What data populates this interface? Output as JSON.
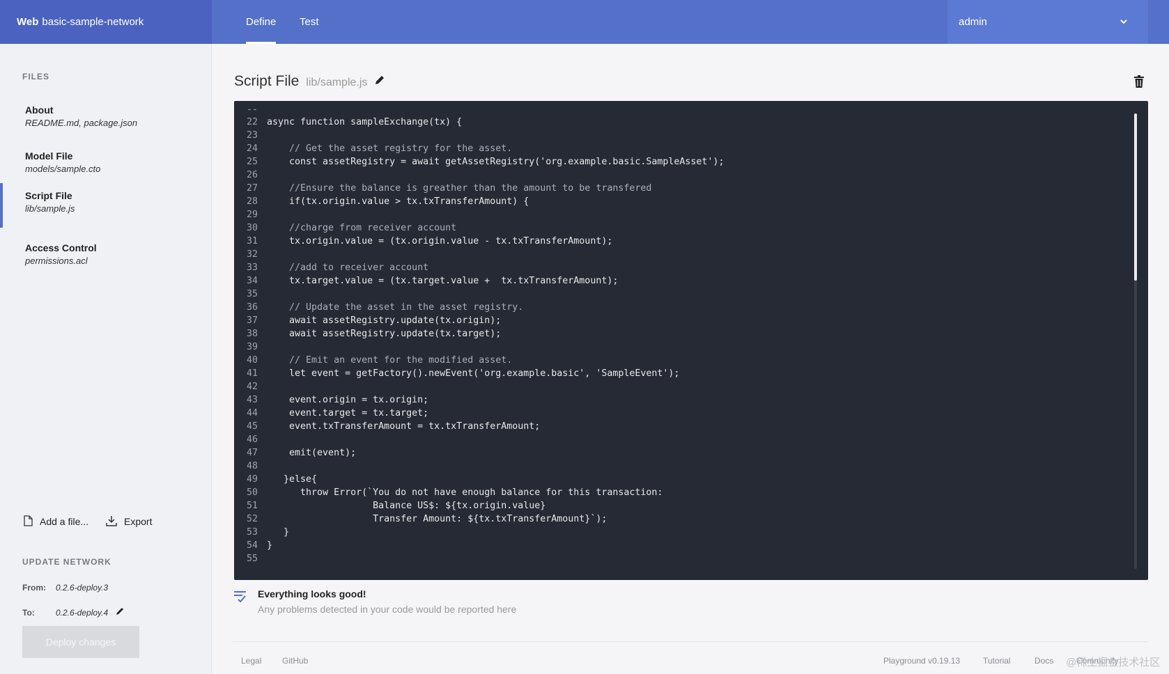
{
  "app": {
    "brand_bold": "Web",
    "brand_name": "basic-sample-network"
  },
  "nav": {
    "tabs": [
      "Define",
      "Test"
    ],
    "active": "Define"
  },
  "user": {
    "name": "admin"
  },
  "sidebar": {
    "files_title": "FILES",
    "files": [
      {
        "name": "About",
        "path": "README.md, package.json"
      },
      {
        "name": "Model File",
        "path": "models/sample.cto"
      },
      {
        "name": "Script File",
        "path": "lib/sample.js"
      },
      {
        "name": "Access Control",
        "path": "permissions.acl"
      }
    ],
    "active_file": "Script File",
    "add_file_label": "Add a file...",
    "export_label": "Export",
    "update_title": "UPDATE NETWORK",
    "from_label": "From:",
    "from_value": "0.2.6-deploy.3",
    "to_label": "To:",
    "to_value": "0.2.6-deploy.4",
    "deploy_label": "Deploy changes"
  },
  "main": {
    "title": "Script File",
    "path": "lib/sample.js"
  },
  "code": [
    {
      "n": "22",
      "t": "async function sampleExchange(tx) {"
    },
    {
      "n": "23",
      "t": ""
    },
    {
      "n": "24",
      "t": "    // Get the asset registry for the asset."
    },
    {
      "n": "25",
      "t": "    const assetRegistry = await getAssetRegistry('org.example.basic.SampleAsset');"
    },
    {
      "n": "26",
      "t": ""
    },
    {
      "n": "27",
      "t": "    //Ensure the balance is greather than the amount to be transfered"
    },
    {
      "n": "28",
      "t": "    if(tx.origin.value > tx.txTransferAmount) {"
    },
    {
      "n": "29",
      "t": ""
    },
    {
      "n": "30",
      "t": "    //charge from receiver account"
    },
    {
      "n": "31",
      "t": "    tx.origin.value = (tx.origin.value - tx.txTransferAmount);"
    },
    {
      "n": "32",
      "t": ""
    },
    {
      "n": "33",
      "t": "    //add to receiver account"
    },
    {
      "n": "34",
      "t": "    tx.target.value = (tx.target.value +  tx.txTransferAmount);"
    },
    {
      "n": "35",
      "t": ""
    },
    {
      "n": "36",
      "t": "    // Update the asset in the asset registry."
    },
    {
      "n": "37",
      "t": "    await assetRegistry.update(tx.origin);"
    },
    {
      "n": "38",
      "t": "    await assetRegistry.update(tx.target);"
    },
    {
      "n": "39",
      "t": ""
    },
    {
      "n": "40",
      "t": "    // Emit an event for the modified asset."
    },
    {
      "n": "41",
      "t": "    let event = getFactory().newEvent('org.example.basic', 'SampleEvent');"
    },
    {
      "n": "42",
      "t": ""
    },
    {
      "n": "43",
      "t": "    event.origin = tx.origin;"
    },
    {
      "n": "44",
      "t": "    event.target = tx.target;"
    },
    {
      "n": "45",
      "t": "    event.txTransferAmount = tx.txTransferAmount;"
    },
    {
      "n": "46",
      "t": ""
    },
    {
      "n": "47",
      "t": "    emit(event);"
    },
    {
      "n": "48",
      "t": ""
    },
    {
      "n": "49",
      "t": "   }else{"
    },
    {
      "n": "50",
      "t": "      throw Error(`You do not have enough balance for this transaction:"
    },
    {
      "n": "51",
      "t": "                   Balance US$: ${tx.origin.value}"
    },
    {
      "n": "52",
      "t": "                   Transfer Amount: ${tx.txTransferAmount}`);"
    },
    {
      "n": "53",
      "t": "   }"
    },
    {
      "n": "54",
      "t": "}"
    },
    {
      "n": "55",
      "t": ""
    }
  ],
  "status": {
    "heading": "Everything looks good!",
    "subtext": "Any problems detected in your code would be reported here"
  },
  "footer": {
    "left": [
      "Legal",
      "GitHub"
    ],
    "version": "Playground v0.19.13",
    "right": [
      "Tutorial",
      "Docs",
      "Community"
    ]
  },
  "watermark": "@稀土掘金技术社区",
  "colors": {
    "topbar": "#5470c8",
    "brand": "#4b62c0",
    "editor_bg": "#252a35"
  }
}
